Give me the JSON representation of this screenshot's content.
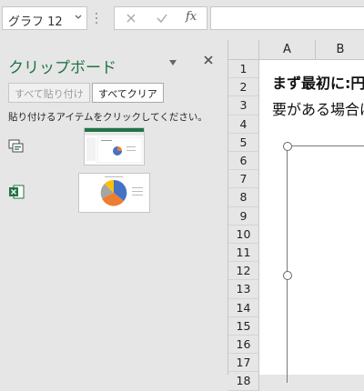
{
  "formula_bar": {
    "name_box": "グラフ 12",
    "cancel_icon": "close-icon",
    "enter_icon": "check-icon",
    "fx_label": "fx",
    "formula_value": ""
  },
  "clipboard": {
    "title": "クリップボード",
    "paste_all": "すべて貼り付け",
    "clear_all": "すべてクリア",
    "instruction": "貼り付けるアイテムをクリックしてください。",
    "items": [
      {
        "app_icon": "copy-screen-icon",
        "kind": "screenshot"
      },
      {
        "app_icon": "excel-icon",
        "kind": "pie-chart"
      }
    ]
  },
  "sheet": {
    "columns": [
      "A",
      "B"
    ],
    "rows": [
      "1",
      "2",
      "3",
      "4",
      "5",
      "6",
      "7",
      "8",
      "9",
      "10",
      "11",
      "12",
      "13",
      "14",
      "15",
      "16",
      "17",
      "18"
    ],
    "cells": {
      "b2": "まず最初に:円",
      "b3": "要がある場合は"
    }
  },
  "colors": {
    "accent": "#217346",
    "pie_blue": "#4472c4",
    "pie_orange": "#ed7d31",
    "pie_gray": "#a5a5a5",
    "pie_yellow": "#ffc000"
  }
}
